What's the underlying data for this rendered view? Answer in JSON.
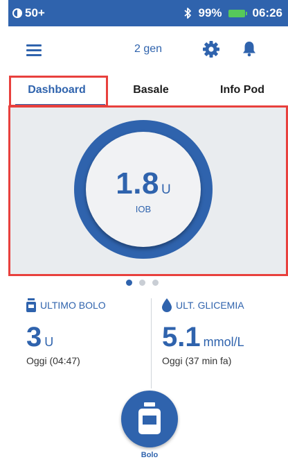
{
  "status_bar": {
    "notification": "50+",
    "battery_percent": "99%",
    "time": "06:26"
  },
  "app_bar": {
    "date": "2 gen"
  },
  "tabs": [
    {
      "label": "Dashboard",
      "selected": true
    },
    {
      "label": "Basale",
      "selected": false
    },
    {
      "label": "Info Pod",
      "selected": false
    }
  ],
  "iob": {
    "value": "1.8",
    "unit": "U",
    "label": "IOB"
  },
  "pager": {
    "pages": 3,
    "active_index": 0
  },
  "last_bolus": {
    "title": "ULTIMO BOLO",
    "value": "3",
    "unit": "U",
    "time": "Oggi (04:47)"
  },
  "last_bg": {
    "title": "ULT. GLICEMIA",
    "value": "5.1",
    "unit": "mmol/L",
    "time": "Oggi (37 min fa)"
  },
  "bolus_button": {
    "label": "Bolo"
  },
  "colors": {
    "primary_blue": "#2f63ad",
    "highlight_red": "#e8403d",
    "battery_green": "#56c95a",
    "panel_gray": "#e9ecef"
  }
}
